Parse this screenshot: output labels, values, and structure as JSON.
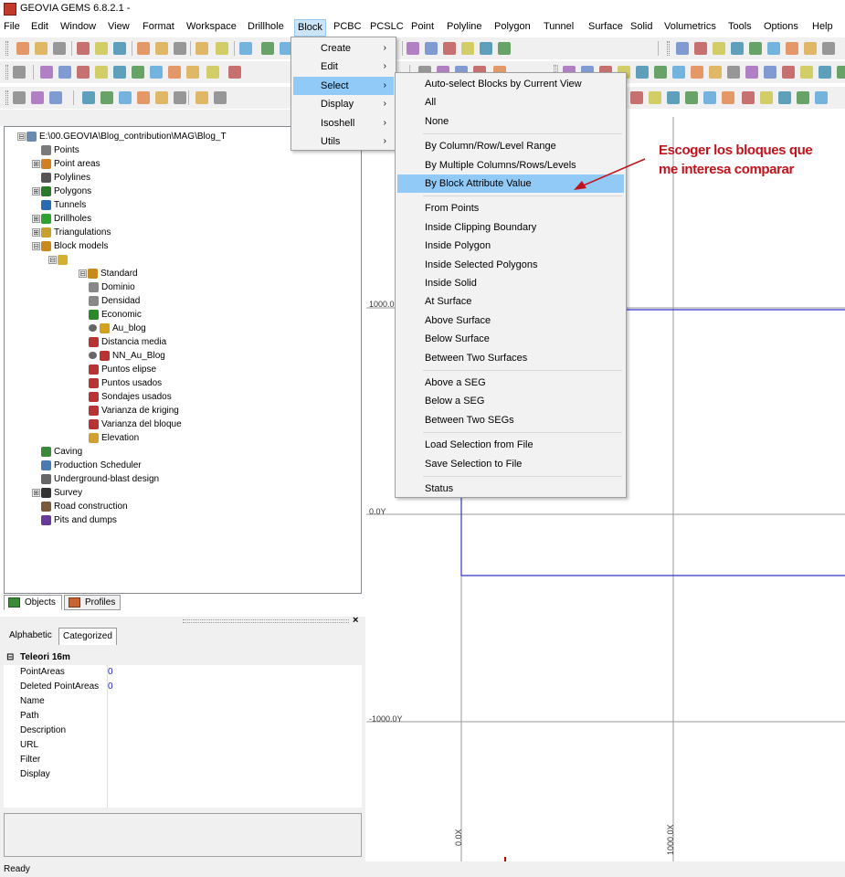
{
  "window": {
    "title": "GEOVIA GEMS 6.8.2.1 -",
    "app_icon": "gems-app-icon"
  },
  "menubar": [
    "File",
    "Edit",
    "Window",
    "View",
    "Format",
    "Workspace",
    "Drillhole",
    "Block",
    "PCBC",
    "PCSLC",
    "Point",
    "Polyline",
    "Polygon",
    "Tunnel",
    "Surface",
    "Solid",
    "Volumetrics",
    "Tools",
    "Options",
    "Help"
  ],
  "block_menu": {
    "items": [
      {
        "label": "Create"
      },
      {
        "label": "Edit"
      },
      {
        "label": "Select"
      },
      {
        "label": "Display"
      },
      {
        "label": "Isoshell"
      },
      {
        "label": "Utils"
      }
    ],
    "active": "Select",
    "arrow": "›"
  },
  "select_submenu": {
    "groups": [
      [
        "Auto-select Blocks by Current View",
        "All",
        "None"
      ],
      [
        "By Column/Row/Level Range",
        "By Multiple Columns/Rows/Levels",
        "By Block Attribute Value"
      ],
      [
        "From Points",
        "Inside Clipping Boundary",
        "Inside Polygon",
        "Inside Selected Polygons",
        "Inside Solid",
        "At Surface",
        "Above Surface",
        "Below Surface",
        "Between Two Surfaces"
      ],
      [
        "Above a SEG",
        "Below a SEG",
        "Between Two SEGs"
      ],
      [
        "Load Selection from File",
        "Save Selection to File"
      ],
      [
        "Status"
      ]
    ],
    "highlighted": "By Block Attribute Value"
  },
  "annotation": {
    "line1": "Escoger los bloques que",
    "line2": "me interesa comparar",
    "color": "#c0131c"
  },
  "tree": {
    "root": "E:\\00.GEOVIA\\Blog_contribution\\MAG\\Blog_T",
    "items": [
      "Points",
      "Point areas",
      "Polylines",
      "Polygons",
      "Tunnels",
      "Drillholes",
      "Triangulations",
      "Block models"
    ],
    "model_name": "Standard",
    "attributes": [
      "Dominio",
      "Densidad",
      "Economic",
      "Au_blog",
      "Distancia media",
      "NN_Au_Blog",
      "Puntos elipse",
      "Puntos usados",
      "Sondajes usados",
      "Varianza de kriging",
      "Varianza del bloque",
      "Elevation"
    ],
    "after": [
      "Caving",
      "Production Scheduler",
      "Underground-blast design",
      "Survey",
      "Road construction",
      "Pits and dumps"
    ]
  },
  "bottom_tabs": {
    "objects": "Objects",
    "profiles": "Profiles"
  },
  "props": {
    "tabs": {
      "alphabetic": "Alphabetic",
      "categorized": "Categorized"
    },
    "group": "Teleori 16m",
    "rows": [
      {
        "k": "PointAreas",
        "v": "0"
      },
      {
        "k": "Deleted PointAreas",
        "v": "0"
      },
      {
        "k": "Name",
        "v": ""
      },
      {
        "k": "Path",
        "v": ""
      },
      {
        "k": "Description",
        "v": ""
      },
      {
        "k": "URL",
        "v": ""
      },
      {
        "k": "Filter",
        "v": ""
      },
      {
        "k": "Display",
        "v": ""
      }
    ]
  },
  "canvas": {
    "labels": {
      "y_top": "1000.0",
      "y_mid": "0.0Y",
      "y_bot": "-1000.0Y",
      "x0": "0.0X",
      "x1": "1000.0X"
    },
    "line_color": "#3333cc"
  },
  "status": "Ready"
}
